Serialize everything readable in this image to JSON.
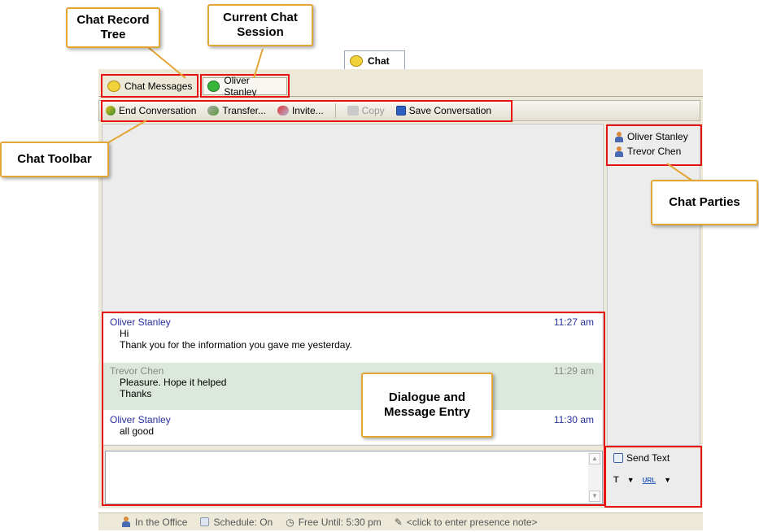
{
  "callouts": {
    "chat_record_tree": "Chat Record Tree",
    "current_chat_session": "Current Chat Session",
    "chat_toolbar": "Chat Toolbar",
    "chat_parties": "Chat Parties",
    "dialogue_entry": "Dialogue and Message Entry"
  },
  "top_tab": {
    "label": "Chat",
    "icon": "chat-bubble-icon"
  },
  "tabs": [
    {
      "label": "Chat Messages",
      "icon": "chat-messages-icon"
    },
    {
      "label": "Oliver Stanley",
      "icon": "green-bubble-icon"
    }
  ],
  "toolbar": {
    "end_conversation": "End Conversation",
    "transfer": "Transfer...",
    "invite": "Invite...",
    "copy": "Copy",
    "save_conversation": "Save Conversation"
  },
  "messages": [
    {
      "sender": "Oliver Stanley",
      "time": "11:27 am",
      "lines": [
        "Hi",
        "Thank you for the information you gave me yesterday."
      ]
    },
    {
      "sender": "Trevor Chen",
      "time": "11:29 am",
      "lines": [
        "Pleasure. Hope it helped",
        "Thanks"
      ]
    },
    {
      "sender": "Oliver Stanley",
      "time": "11:30 am",
      "lines": [
        "all good"
      ]
    }
  ],
  "parties": [
    "Oliver Stanley",
    "Trevor Chen"
  ],
  "send": {
    "send_text": "Send Text"
  },
  "status": {
    "presence": "In the Office",
    "schedule": "Schedule: On",
    "free_until": "Free Until: 5:30 pm",
    "note": "<click to enter presence note>"
  },
  "colors": {
    "callout_border": "#e3a634",
    "highlight": "#e81212",
    "sender_blue": "#27309a"
  }
}
